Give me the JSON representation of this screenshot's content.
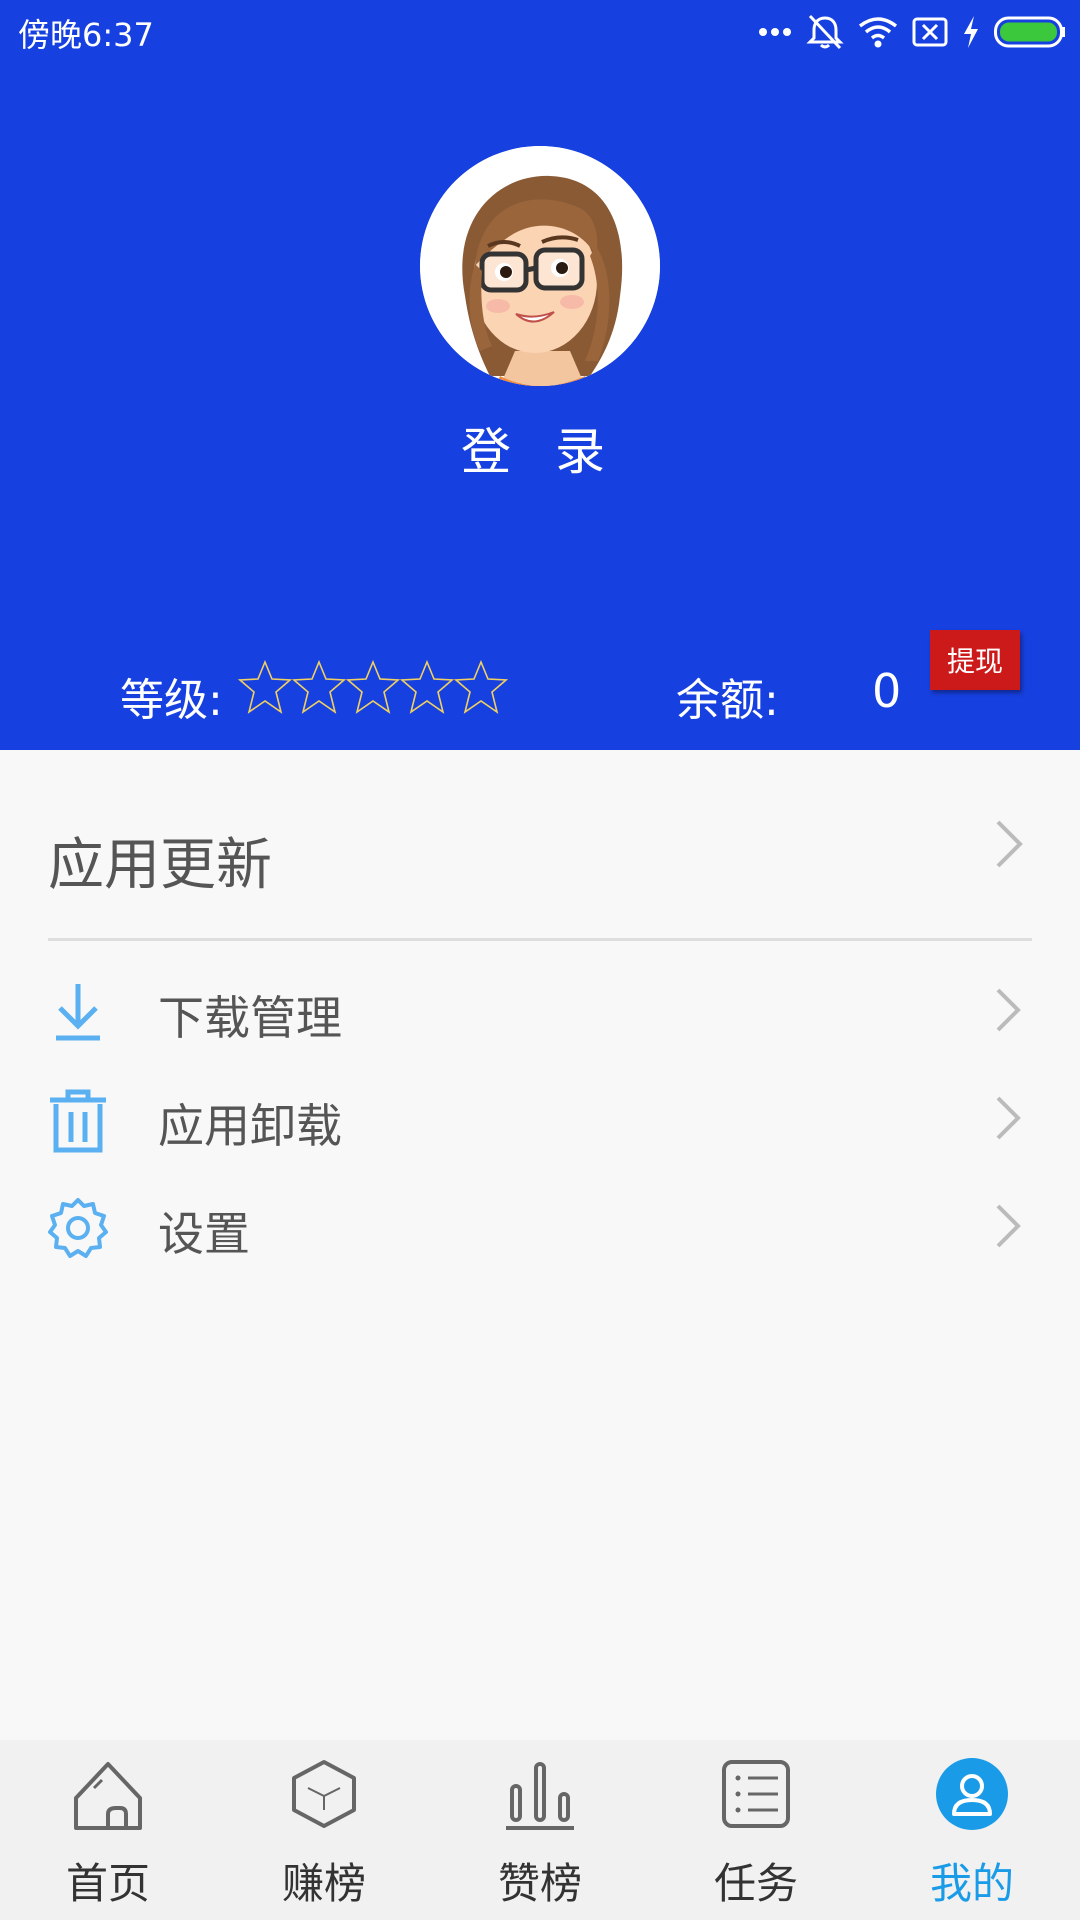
{
  "status_bar": {
    "time": "傍晚6:37",
    "icons": [
      "more-dots-icon",
      "alarm-off-icon",
      "wifi-icon",
      "sim-x-icon",
      "charging-icon",
      "battery-icon"
    ],
    "battery_color": "#3cc83c"
  },
  "header": {
    "bg_color": "#1740e0",
    "login_label": "登 录",
    "level_label": "等级:",
    "stars_filled": 0,
    "stars_total": 5,
    "balance_label": "余额:",
    "balance_value": "0",
    "withdraw_label": "提现",
    "withdraw_color": "#cc1a1a"
  },
  "menu": {
    "update_label": "应用更新",
    "items": [
      {
        "label": "下载管理",
        "icon": "download-icon"
      },
      {
        "label": "应用卸载",
        "icon": "trash-icon"
      },
      {
        "label": "设置",
        "icon": "gear-icon"
      }
    ],
    "icon_color": "#5ab0f0"
  },
  "bottom_nav": {
    "items": [
      {
        "label": "首页",
        "icon": "home-icon",
        "active": false
      },
      {
        "label": "赚榜",
        "icon": "cube-icon",
        "active": false
      },
      {
        "label": "赞榜",
        "icon": "bar-chart-icon",
        "active": false
      },
      {
        "label": "任务",
        "icon": "task-list-icon",
        "active": false
      },
      {
        "label": "我的",
        "icon": "user-icon",
        "active": true
      }
    ],
    "active_color": "#1a9be8"
  }
}
